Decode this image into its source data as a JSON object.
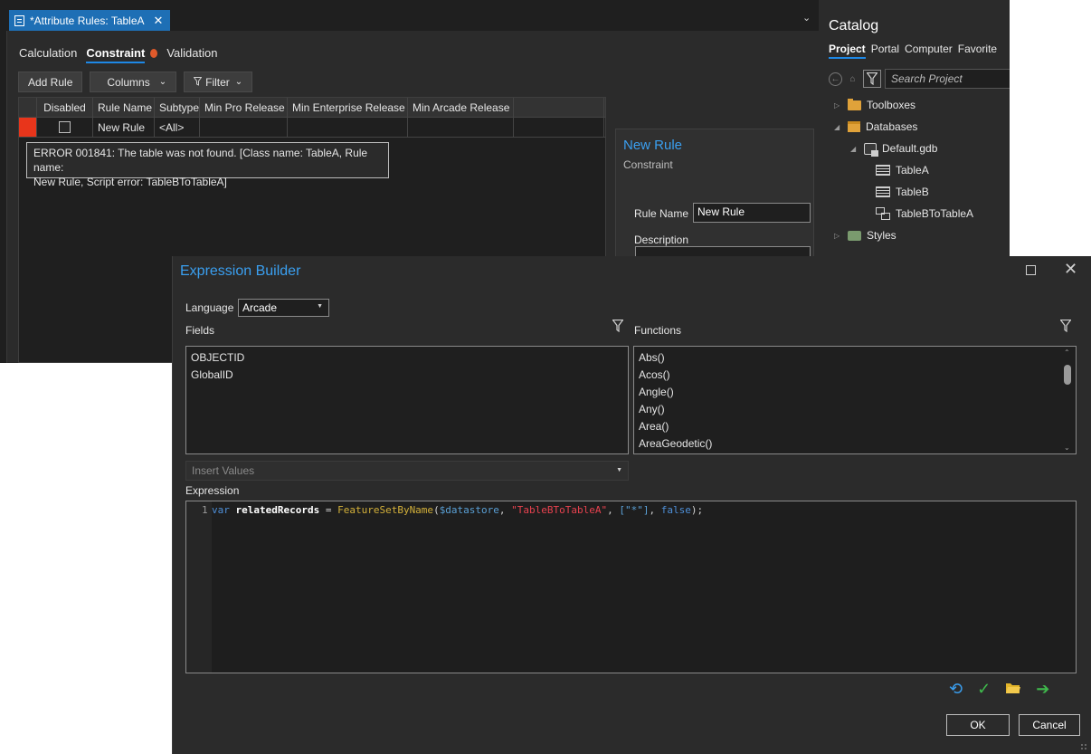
{
  "attribute_rules": {
    "tab_title": "*Attribute Rules: TableA",
    "subtabs": [
      "Calculation",
      "Constraint",
      "Validation"
    ],
    "active_subtab": "Constraint",
    "toolbar": {
      "add_rule": "Add Rule",
      "columns": "Columns",
      "filter": "Filter"
    },
    "grid": {
      "columns": [
        "Disabled",
        "Rule Name",
        "Subtype",
        "Min Pro Release",
        "Min Enterprise Release",
        "Min Arcade Release"
      ],
      "rows": [
        {
          "disabled": false,
          "rule_name": "New Rule",
          "subtype": "<All>"
        }
      ]
    },
    "error_tooltip": {
      "line1": "ERROR 001841: The table was not found. [Class name: TableA, Rule name:",
      "line2": "New Rule, Script error: TableBToTableA]"
    },
    "rule_props": {
      "title": "New Rule",
      "type": "Constraint",
      "rule_name_label": "Rule Name",
      "rule_name_value": "New Rule",
      "description_label": "Description"
    }
  },
  "catalog": {
    "title": "Catalog",
    "tabs": [
      "Project",
      "Portal",
      "Computer",
      "Favorite"
    ],
    "active_tab": "Project",
    "search_placeholder": "Search Project",
    "tree": {
      "toolboxes": "Toolboxes",
      "databases": "Databases",
      "default_gdb": "Default.gdb",
      "table_a": "TableA",
      "table_b": "TableB",
      "relationship": "TableBToTableA",
      "styles": "Styles"
    }
  },
  "expression_builder": {
    "title": "Expression Builder",
    "language_label": "Language",
    "language_value": "Arcade",
    "fields_label": "Fields",
    "fields": [
      "OBJECTID",
      "GlobalID"
    ],
    "functions_label": "Functions",
    "functions": [
      "Abs()",
      "Acos()",
      "Angle()",
      "Any()",
      "Area()",
      "AreaGeodetic()"
    ],
    "insert_values_placeholder": "Insert Values",
    "expression_label": "Expression",
    "code": {
      "line_number": "1",
      "keyword": "var",
      "identifier": "relatedRecords",
      "equals": " = ",
      "function": "FeatureSetByName",
      "open": "(",
      "arg_datastore": "$datastore",
      "comma1": ", ",
      "arg_table": "\"TableBToTableA\"",
      "comma2": ", ",
      "arg_fields": "[\"*\"]",
      "comma3": ", ",
      "arg_bool": "false",
      "close": ");"
    },
    "ok": "OK",
    "cancel": "Cancel"
  },
  "icon_colors": {
    "accent": "#1e6fb5",
    "error": "#e8351b",
    "verify": "#3fb94c",
    "load": "#e3b52a"
  }
}
